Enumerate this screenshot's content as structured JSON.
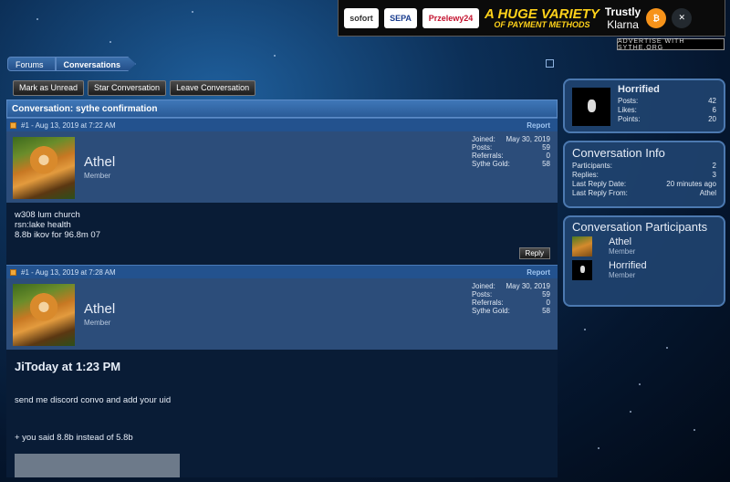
{
  "ad": {
    "logos": [
      "sofort",
      "SEPA",
      "Przelewy24",
      "Klarna"
    ],
    "headline": "A HUGE VARIETY",
    "subline": "OF PAYMENT METHODS",
    "trusty": "Trustly",
    "advertise": "Advertise with sythe.org"
  },
  "breadcrumb": {
    "forums": "Forums",
    "conversations": "Conversations"
  },
  "buttons": {
    "mark_unread": "Mark as Unread",
    "star": "Star Conversation",
    "leave": "Leave Conversation"
  },
  "conversation": {
    "title": "Conversation: sythe confirmation"
  },
  "messages": [
    {
      "header": "#1 - Aug 13, 2019 at 7:22 AM",
      "report": "Report",
      "user": {
        "name": "Athel",
        "role": "Member"
      },
      "stats": [
        {
          "label": "Joined:",
          "value": "May 30, 2019"
        },
        {
          "label": "Posts:",
          "value": "59"
        },
        {
          "label": "Referrals:",
          "value": "0"
        },
        {
          "label": "Sythe Gold:",
          "value": "58"
        }
      ],
      "lines": [
        "w308 lum church",
        "rsn:lake health",
        "8.8b ikov for 96.8m 07"
      ],
      "reply": "Reply"
    },
    {
      "header": "#1 - Aug 13, 2019 at 7:28 AM",
      "report": "Report",
      "user": {
        "name": "Athel",
        "role": "Member"
      },
      "stats": [
        {
          "label": "Joined:",
          "value": "May 30, 2019"
        },
        {
          "label": "Posts:",
          "value": "59"
        },
        {
          "label": "Referrals:",
          "value": "0"
        },
        {
          "label": "Sythe Gold:",
          "value": "58"
        }
      ],
      "big": "JiToday at 1:23 PM",
      "line1": "send me discord convo and add your uid",
      "line2": "+ you said 8.8b instead of 5.8b"
    }
  ],
  "sidebar": {
    "profile": {
      "name": "Horrified",
      "stats": [
        {
          "label": "Posts:",
          "value": "42"
        },
        {
          "label": "Likes:",
          "value": "6"
        },
        {
          "label": "Points:",
          "value": "20"
        }
      ]
    },
    "info": {
      "title": "Conversation Info",
      "rows": [
        {
          "label": "Participants:",
          "value": "2"
        },
        {
          "label": "Replies:",
          "value": "3"
        },
        {
          "label": "Last Reply Date:",
          "value": "20 minutes ago"
        },
        {
          "label": "Last Reply From:",
          "value": "Athel"
        }
      ]
    },
    "participants": {
      "title": "Conversation Participants",
      "list": [
        {
          "name": "Athel",
          "role": "Member"
        },
        {
          "name": "Horrified",
          "role": "Member"
        }
      ]
    }
  }
}
